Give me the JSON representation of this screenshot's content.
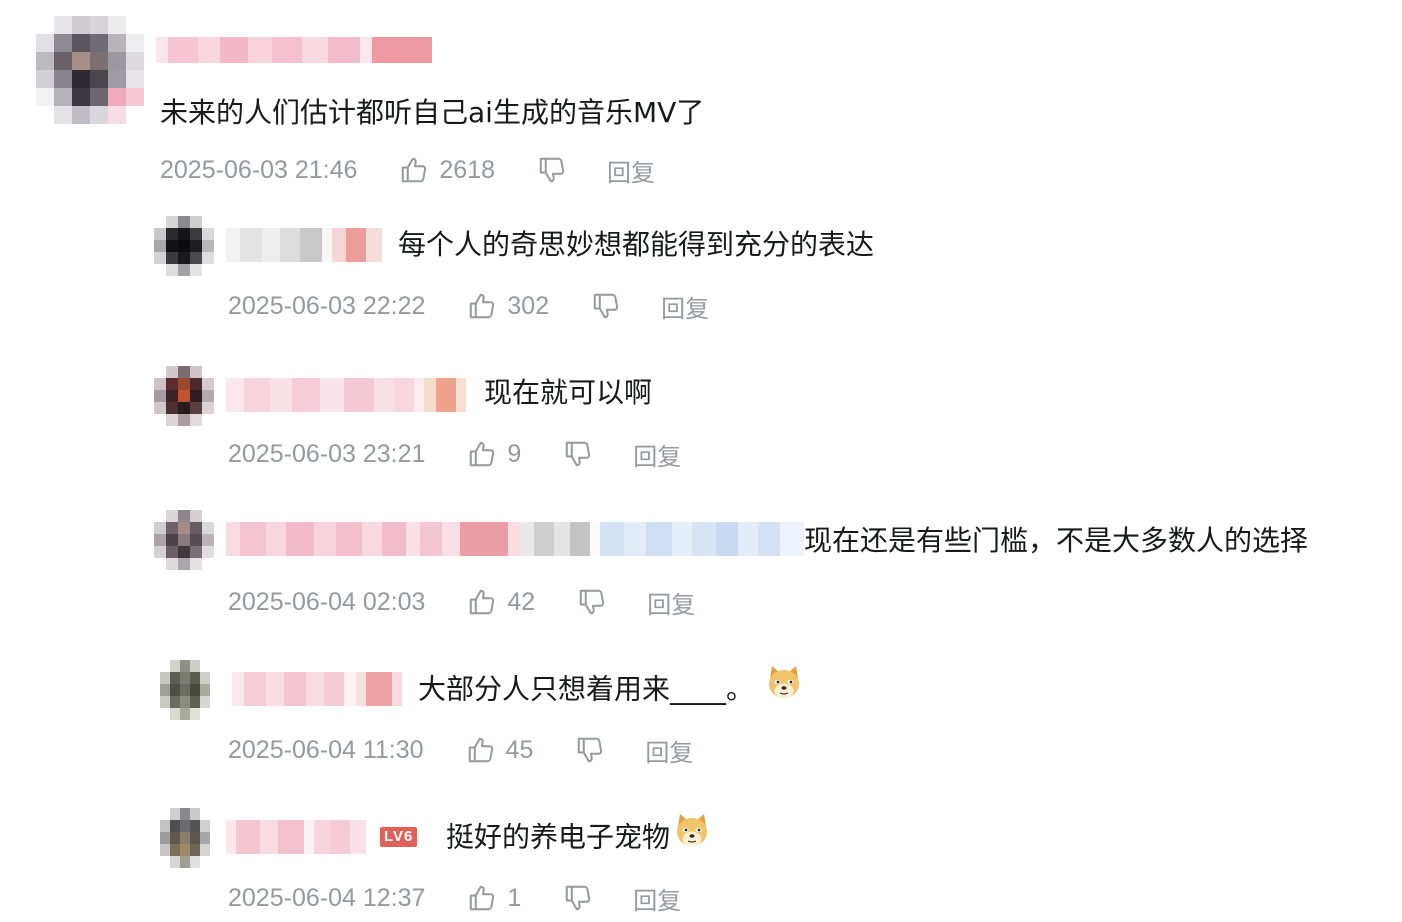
{
  "actions": {
    "reply_label": "回复"
  },
  "lv_badge": "LV6",
  "comments": [
    {
      "text": "未来的人们估计都听自己ai生成的音乐MV了",
      "time": "2025-06-03 21:46",
      "likes": "2618"
    },
    {
      "text": "每个人的奇思妙想都能得到充分的表达",
      "time": "2025-06-03 22:22",
      "likes": "302"
    },
    {
      "text": "现在就可以啊",
      "time": "2025-06-03 23:21",
      "likes": "9"
    },
    {
      "text": "现在还是有些门槛，不是大多数人的选择",
      "time": "2025-06-04 02:03",
      "likes": "42"
    },
    {
      "text": "大部分人只想着用来____。",
      "time": "2025-06-04 11:30",
      "likes": "45"
    },
    {
      "text": "挺好的养电子宠物",
      "time": "2025-06-04 12:37",
      "likes": "1"
    }
  ],
  "icons": {
    "like": "thumbs-up-icon",
    "dislike": "thumbs-down-icon",
    "emoji": "doge-emoji-icon"
  },
  "colors": {
    "text": "#18191c",
    "meta": "#9499a0",
    "badge": "#e0605a"
  }
}
